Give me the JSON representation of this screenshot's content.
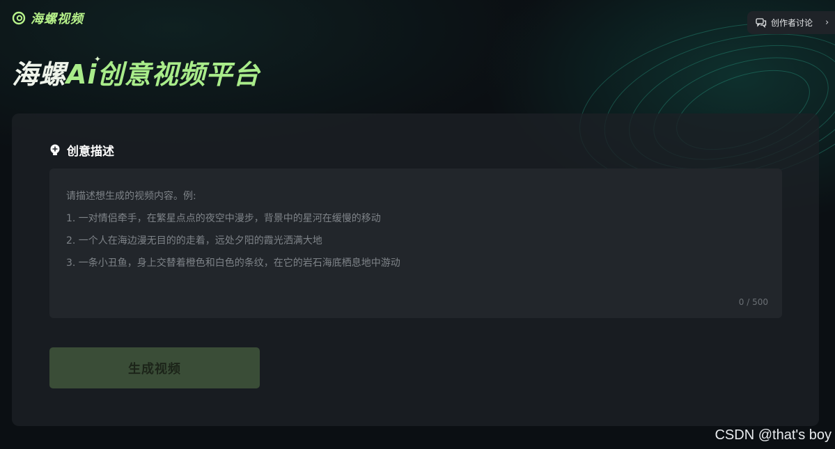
{
  "brand": {
    "logo_text": "海螺视频",
    "accent_color": "#b7f28a"
  },
  "header": {
    "discuss_button_label": "创作者讨论",
    "discuss_icon": "chat-bubbles-icon"
  },
  "hero": {
    "title_main": "海螺",
    "title_accent": "Ai创意视频平台"
  },
  "creative": {
    "section_title": "创意描述",
    "section_icon": "lightbulb-icon",
    "placeholder_lines": [
      "请描述想生成的视频内容。例:",
      "1. 一对情侣牵手，在繁星点点的夜空中漫步，背景中的星河在缓慢的移动",
      "2. 一个人在海边漫无目的的走着，远处夕阳的霞光洒满大地",
      "3. 一条小丑鱼，身上交替着橙色和白色的条纹，在它的岩石海底栖息地中游动"
    ],
    "char_count": "0 / 500"
  },
  "actions": {
    "generate_label": "生成视频"
  },
  "watermark": "CSDN @that's boy"
}
